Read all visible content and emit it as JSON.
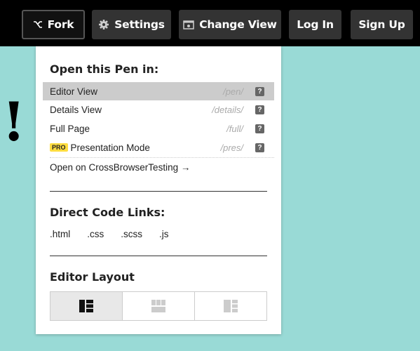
{
  "topbar": {
    "fork_label": "Fork",
    "settings_label": "Settings",
    "change_view_label": "Change View",
    "login_label": "Log In",
    "signup_label": "Sign Up"
  },
  "background_text": "!",
  "panel": {
    "open_heading": "Open this Pen in:",
    "views": [
      {
        "label": "Editor View",
        "path": "/pen/",
        "help": "?"
      },
      {
        "label": "Details View",
        "path": "/details/",
        "help": "?"
      },
      {
        "label": "Full Page",
        "path": "/full/",
        "help": "?"
      },
      {
        "label": "Presentation Mode",
        "path": "/pres/",
        "help": "?",
        "badge": "PRO"
      }
    ],
    "crossbrowser_link": "Open on CrossBrowserTesting →",
    "code_heading": "Direct Code Links:",
    "code_links": [
      ".html",
      ".css",
      ".scss",
      ".js"
    ],
    "layout_heading": "Editor Layout"
  },
  "colors": {
    "background": "#99dad6",
    "topbar": "#000000",
    "button": "#333333",
    "active_row": "#cccccc",
    "pro_badge": "#ffdd40"
  }
}
